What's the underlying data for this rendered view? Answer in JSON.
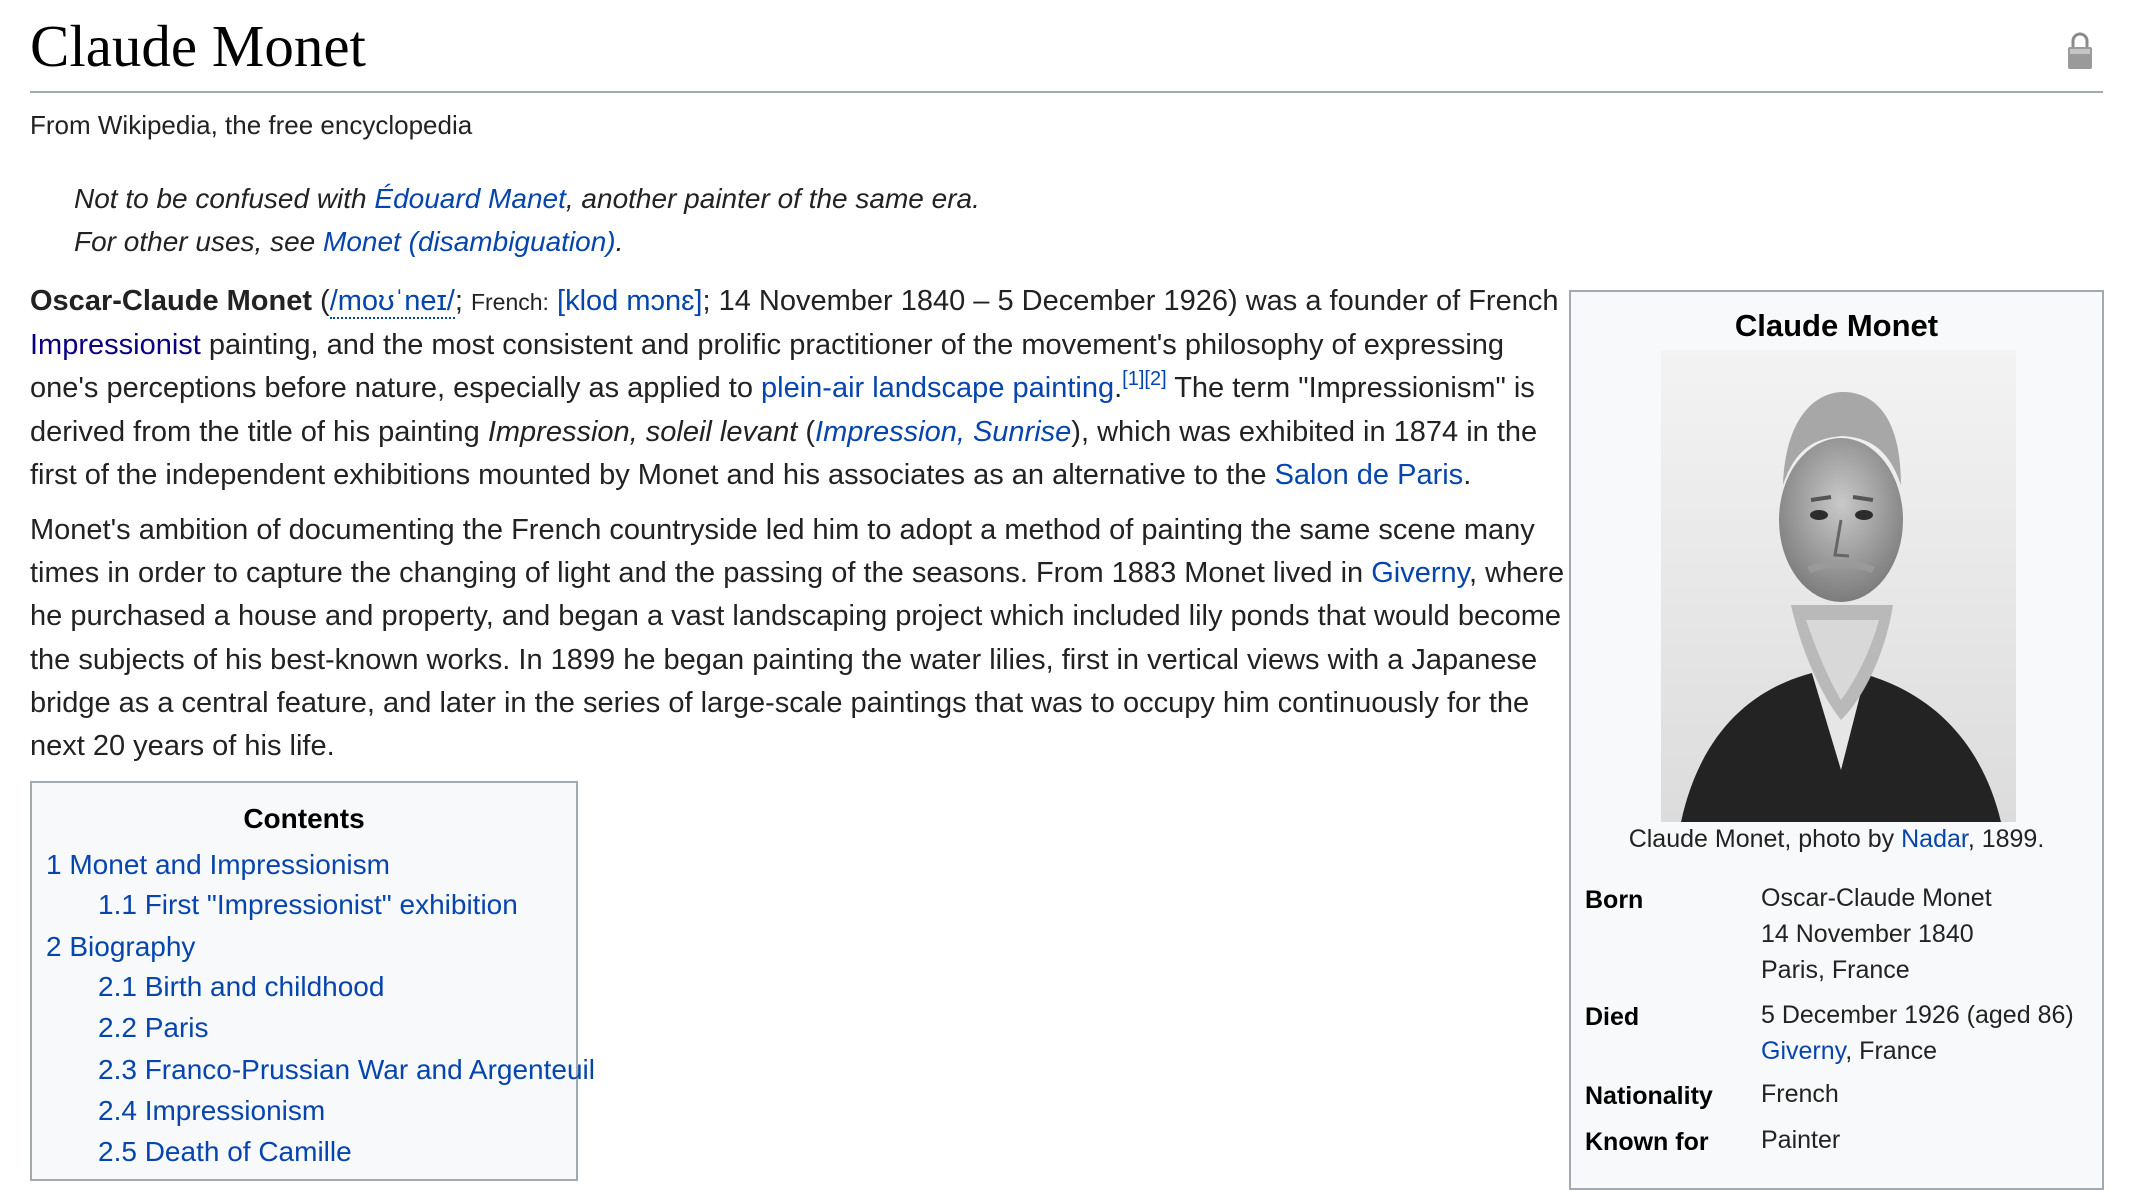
{
  "title": "Claude Monet",
  "tagline": "From Wikipedia, the free encyclopedia",
  "icons": {
    "lock": "lock-icon"
  },
  "hatnotes": [
    {
      "prefix": "Not to be confused with ",
      "link": "Édouard Manet",
      "suffix": ", another painter of the same era."
    },
    {
      "prefix": "For other uses, see ",
      "link": "Monet (disambiguation)",
      "suffix": "."
    }
  ],
  "intro": {
    "name": "Oscar-Claude Monet",
    "open_paren": " (",
    "ipa_en": "/moʊˈneɪ/",
    "semi": "; ",
    "french_label": "French:",
    "ipa_fr": "[klod mɔnɛ]",
    "dates": "; 14 November 1840 – 5 December 1926) was a founder of French ",
    "impressionist_link": "Impressionist",
    "text1": " painting, and the most consistent and prolific practitioner of the movement's philosophy of expressing one's perceptions before nature, especially as applied to ",
    "plein_air_link": "plein-air landscape painting",
    "period": ".",
    "ref1": "[1]",
    "ref2": "[2]",
    "text2": " The term \"Impressionism\" is derived from the title of his painting ",
    "painting_title": "Impression, soleil levant",
    "paren_open": " (",
    "painting_link": "Impression, Sunrise",
    "text3": "), which was exhibited in 1874 in the first of the independent exhibitions mounted by Monet and his associates as an alternative to the ",
    "salon_link": "Salon de Paris",
    "end": "."
  },
  "para2": {
    "text1": "Monet's ambition of documenting the French countryside led him to adopt a method of painting the same scene many times in order to capture the changing of light and the passing of the seasons. From 1883 Monet lived in ",
    "giverny_link": "Giverny",
    "text2": ", where he purchased a house and property, and began a vast landscaping project which included lily ponds that would become the subjects of his best-known works. In 1899 he began painting the water lilies, first in vertical views with a Japanese bridge as a central feature, and later in the series of large-scale paintings that was to occupy him continuously for the next 20 years of his life."
  },
  "toc": {
    "title": "Contents",
    "items": [
      "1 Monet and Impressionism",
      "1.1 First \"Impressionist\" exhibition",
      "2 Biography",
      "2.1 Birth and childhood",
      "2.2 Paris",
      "2.3 Franco-Prussian War and Argenteuil",
      "2.4 Impressionism",
      "2.5 Death of Camille"
    ]
  },
  "infobox": {
    "title": "Claude Monet",
    "caption_prefix": "Claude Monet, photo by ",
    "caption_link": "Nadar",
    "caption_suffix": ", 1899.",
    "born_label": "Born",
    "born_lines": [
      "Oscar-Claude Monet",
      "14 November 1840",
      "Paris, France"
    ],
    "died_label": "Died",
    "died_line1": "5 December 1926 (aged 86)",
    "died_link": "Giverny",
    "died_suffix": ", France",
    "nationality_label": "Nationality",
    "nationality": "French",
    "known_label": "Known for",
    "known": "Painter"
  }
}
